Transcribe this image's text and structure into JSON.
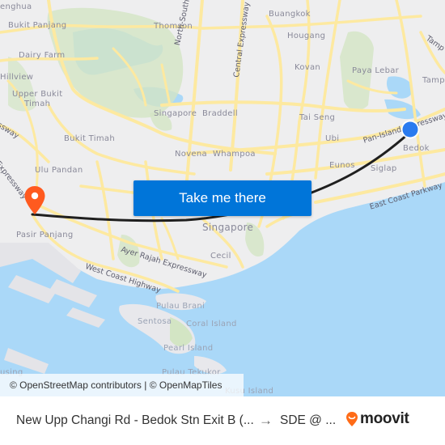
{
  "map": {
    "labels": {
      "tengah": "enghua",
      "bukit_panjang": "Bukit Panjang",
      "dairy_farm": "Dairy Farm",
      "hillview": "Hillview",
      "upper_bukit_timah_1": "Upper Bukit",
      "upper_bukit_timah_2": "Timah",
      "bukit_timah": "Bukit Timah",
      "ulu_pandan": "Ulu Pandan",
      "pasir_panjang": "Pasir Panjang",
      "thomson": "Thomson",
      "singapore_north": "Singapore",
      "braddell": "Braddell",
      "novena": "Novena",
      "whampoa": "Whampoa",
      "buangkok": "Buangkok",
      "hougang": "Hougang",
      "kovan": "Kovan",
      "paya_lebar": "Paya Lebar",
      "tampines_1": "Tamp",
      "tampines_2": "Tamp",
      "tai_seng": "Tai Seng",
      "ubi": "Ubi",
      "eunos": "Eunos",
      "siglap": "Siglap",
      "bedok": "Bedok",
      "singapore_center": "Singapore",
      "cecil": "Cecil",
      "pulau_brani": "Pulau Brani",
      "sentosa": "Sentosa",
      "coral_island": "Coral Island",
      "pearl_island": "Pearl Island",
      "pulau_tekukor": "Pulau Tekukor",
      "kusu_island": "Kusu Island",
      "busing": "using"
    },
    "roads": {
      "north_south_expressway": "North-South Expressway",
      "central_expressway": "Central Expressway",
      "pan_island_expressway": "Pan-Island Expressway",
      "tampines_expressway": "Tamp",
      "east_coast_parkway": "East Coast Parkway",
      "ayer_rajah_expressway": "Ayer Rajah Expressway",
      "west_coast_highway": "West Coast Highway",
      "bke_expressway": "Expressway",
      "expressway_left": "ssway"
    },
    "colors": {
      "land": "#eeeeef",
      "water": "#aad8f8",
      "park": "#d3e5c4",
      "road": "#fde9a0",
      "route": "#1f1f1f",
      "origin_dot": "#2a7bef",
      "destination_pin": "#ff5a1f",
      "button": "#0075d9"
    },
    "take_me_there_label": "Take me there",
    "attribution": "© OpenStreetMap contributors | © OpenMapTiles"
  },
  "footer": {
    "from": "New Upp Changi Rd - Bedok Stn Exit B (...",
    "arrow": "→",
    "to": "SDE @ ...",
    "brand": "moovit",
    "brand_color": "#ff6b17"
  }
}
